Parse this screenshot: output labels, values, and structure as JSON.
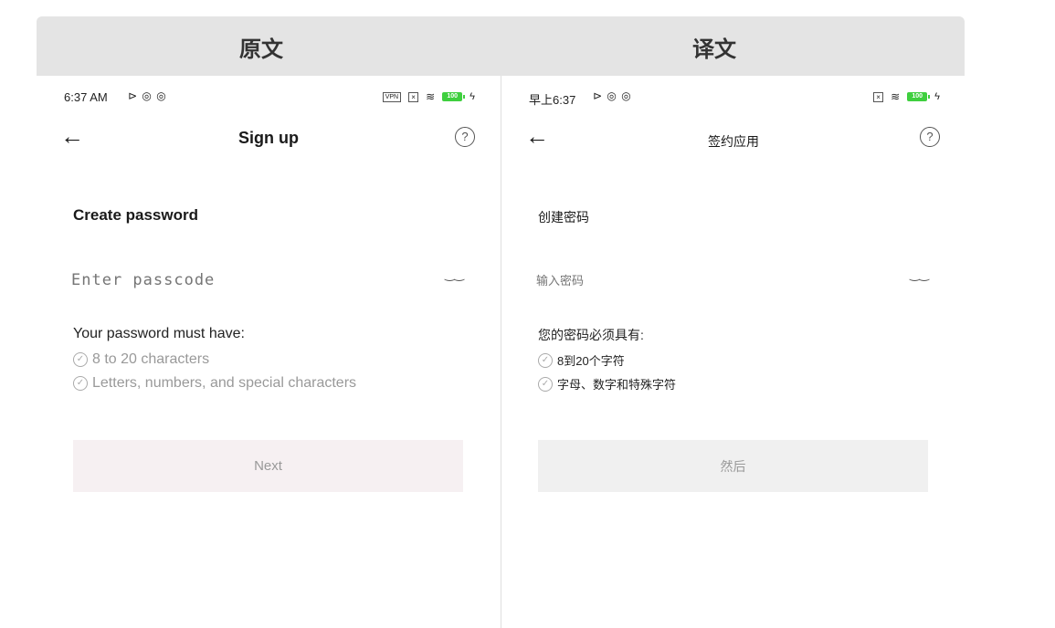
{
  "header": {
    "left_title": "原文",
    "right_title": "译文"
  },
  "original": {
    "status": {
      "time": "6:37 AM",
      "glyphs": "⊳ ◎ ◎",
      "vpn": "VPN",
      "sim": "×",
      "wifi": "≋",
      "battery": "100",
      "bolt": "ϟ"
    },
    "back_icon": "←",
    "title": "Sign up",
    "help_icon": "?",
    "heading": "Create password",
    "input_placeholder": "Enter passcode",
    "eye_icon": "‿‿",
    "requirements_title": "Your password must have:",
    "requirements": [
      "8 to 20 characters",
      "Letters, numbers, and special characters"
    ],
    "check_icon": "✓",
    "button": "Next"
  },
  "translated": {
    "status": {
      "time": "早上6:37",
      "glyphs": "⊳ ◎ ◎",
      "sim": "×",
      "wifi": "≋",
      "battery": "100",
      "bolt": "ϟ"
    },
    "back_icon": "←",
    "title": "签约应用",
    "help_icon": "?",
    "heading": "创建密码",
    "input_placeholder": "输入密码",
    "eye_icon": "‿‿",
    "requirements_title": "您的密码必须具有:",
    "requirements": [
      "8到20个字符",
      "字母、数字和特殊字符"
    ],
    "check_icon": "✓",
    "button": "然后"
  },
  "colors": {
    "header_bg": "#e4e4e4",
    "button_bg_original": "#f6f0f2",
    "button_bg_translated": "#f0f0f0",
    "battery_green": "#3fcf3f"
  }
}
